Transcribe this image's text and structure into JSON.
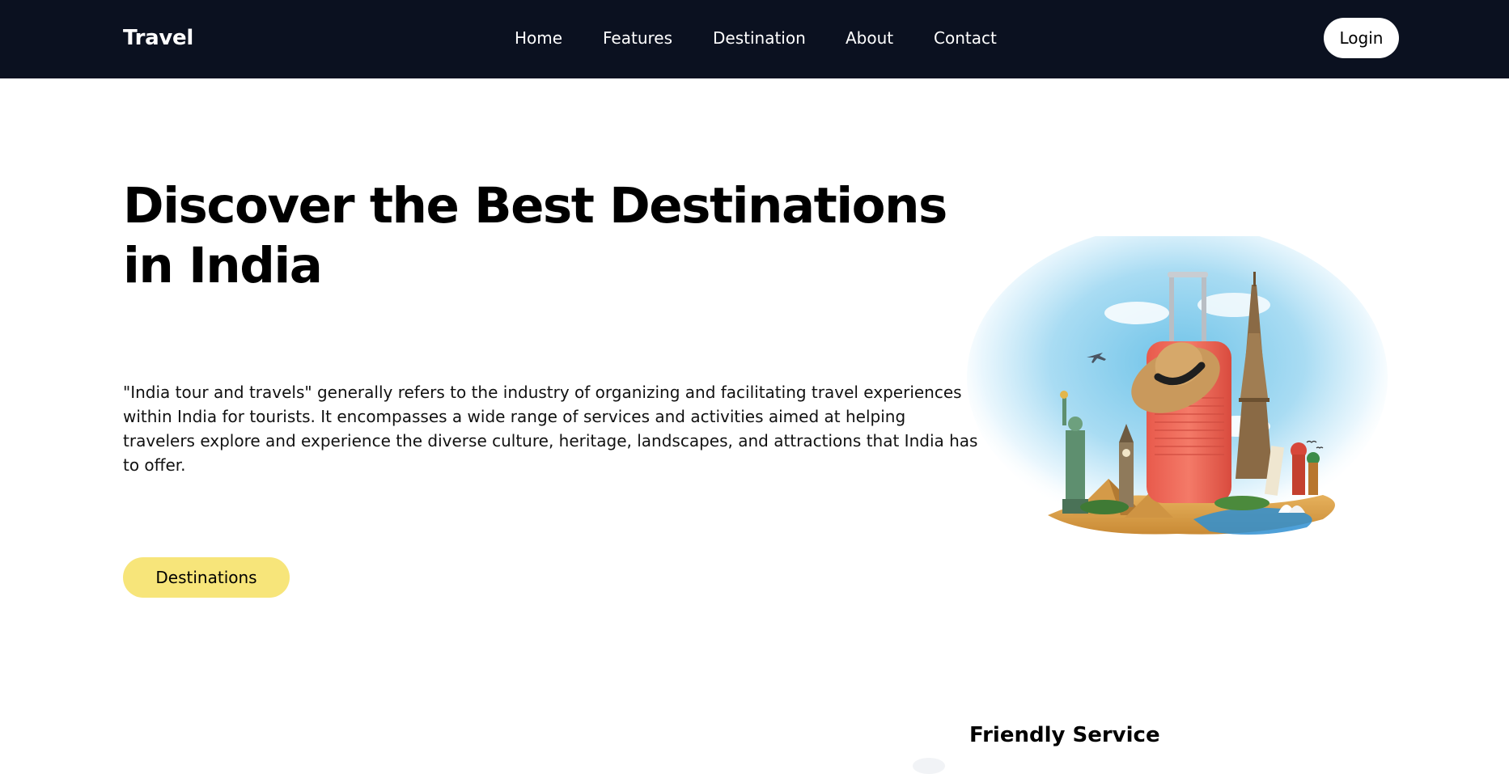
{
  "navbar": {
    "brand": "Travel",
    "links": [
      {
        "label": "Home"
      },
      {
        "label": "Features"
      },
      {
        "label": "Destination"
      },
      {
        "label": "About"
      },
      {
        "label": "Contact"
      }
    ],
    "login_label": "Login"
  },
  "hero": {
    "title": "Discover the Best Destinations in India",
    "description": "\"India tour and travels\" generally refers to the industry of organizing and facilitating travel experiences within India for tourists. It encompasses a wide range of services and activities aimed at helping travelers explore and experience the diverse culture, heritage, landscapes, and attractions that India has to offer.",
    "cta_label": "Destinations"
  },
  "feature": {
    "title": "Friendly Service"
  },
  "colors": {
    "navbar_bg": "#0b1120",
    "cta_bg": "#f7e57a",
    "suitcase": "#f26b5b"
  },
  "icons": {
    "hero_illustration": "travel-landmarks-suitcase-illustration"
  }
}
